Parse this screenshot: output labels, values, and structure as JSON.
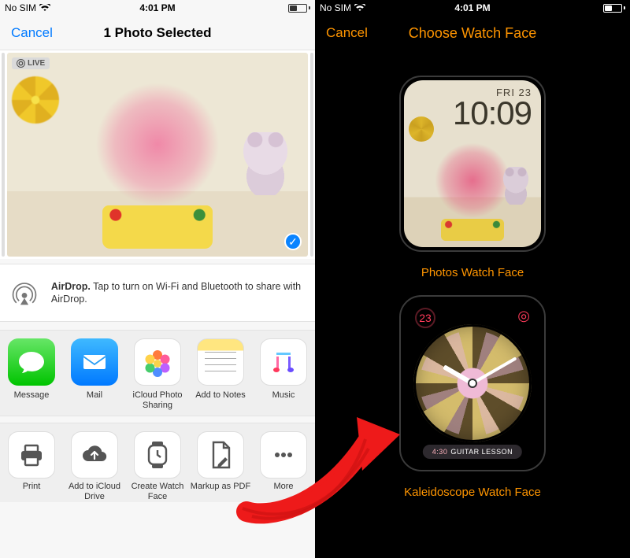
{
  "status": {
    "carrier": "No SIM",
    "time": "4:01 PM"
  },
  "left": {
    "cancel": "Cancel",
    "title": "1 Photo Selected",
    "live_badge": "LIVE",
    "airdrop": {
      "bold": "AirDrop.",
      "text": " Tap to turn on Wi-Fi and Bluetooth to share with AirDrop."
    },
    "share_row": [
      {
        "name": "message",
        "label": "Message"
      },
      {
        "name": "mail",
        "label": "Mail"
      },
      {
        "name": "icloud-photo-sharing",
        "label": "iCloud Photo Sharing"
      },
      {
        "name": "add-to-notes",
        "label": "Add to Notes"
      },
      {
        "name": "music",
        "label": "Music"
      }
    ],
    "action_row": [
      {
        "name": "print",
        "label": "Print"
      },
      {
        "name": "add-to-icloud-drive",
        "label": "Add to iCloud Drive"
      },
      {
        "name": "create-watch-face",
        "label": "Create Watch Face"
      },
      {
        "name": "markup-as-pdf",
        "label": "Markup as PDF"
      },
      {
        "name": "more",
        "label": "More"
      }
    ]
  },
  "right": {
    "cancel": "Cancel",
    "title": "Choose Watch Face",
    "photos_face": {
      "day": "FRI 23",
      "time": "10:09",
      "label": "Photos Watch Face"
    },
    "kaleido_face": {
      "date": "23",
      "pill_time": "4:30",
      "pill_text": "GUITAR LESSON",
      "label": "Kaleidoscope Watch Face"
    }
  }
}
